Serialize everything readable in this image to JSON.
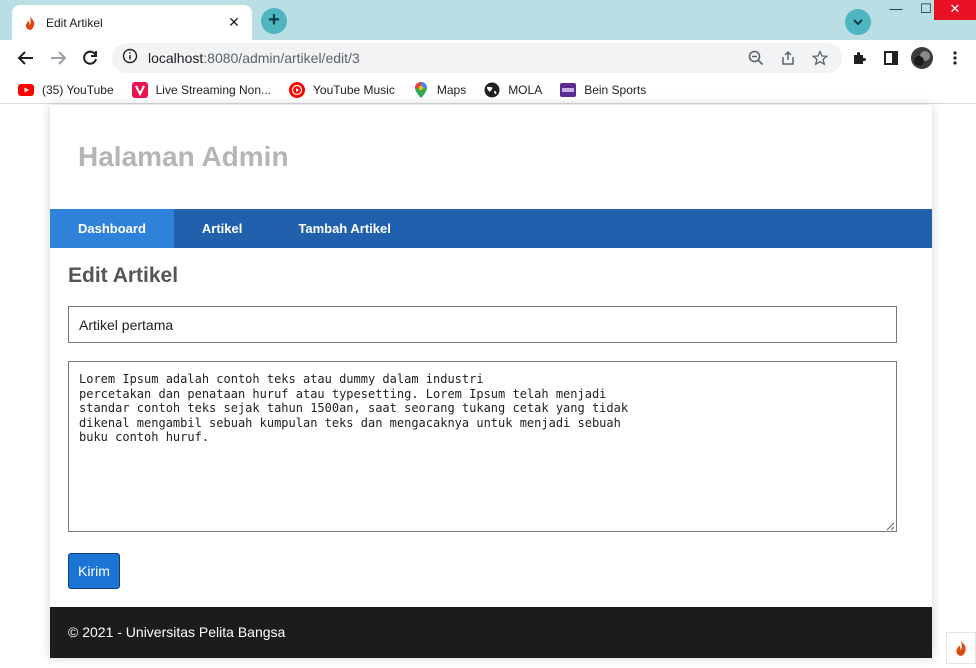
{
  "browser": {
    "tab_title": "Edit Artikel",
    "url_host": "localhost",
    "url_path": ":8080/admin/artikel/edit/3",
    "bookmarks": [
      {
        "label": "(35) YouTube",
        "icon": "youtube-icon"
      },
      {
        "label": "Live Streaming Non...",
        "icon": "vidio-icon"
      },
      {
        "label": "YouTube Music",
        "icon": "youtube-music-icon"
      },
      {
        "label": "Maps",
        "icon": "maps-pin-icon"
      },
      {
        "label": "MOLA",
        "icon": "globe-icon"
      },
      {
        "label": "Bein Sports",
        "icon": "bein-icon"
      }
    ],
    "accent_color": "#b9dfe4"
  },
  "page": {
    "site_title": "Halaman Admin",
    "nav": [
      {
        "label": "Dashboard",
        "active": true
      },
      {
        "label": "Artikel",
        "active": false
      },
      {
        "label": "Tambah Artikel",
        "active": false
      }
    ],
    "heading": "Edit Artikel",
    "form": {
      "title_value": "Artikel pertama",
      "body_value": "Lorem Ipsum adalah contoh teks atau dummy dalam industri\npercetakan dan penataan huruf atau typesetting. Lorem Ipsum telah menjadi\nstandar contoh teks sejak tahun 1500an, saat seorang tukang cetak yang tidak\ndikenal mengambil sebuah kumpulan teks dan mengacaknya untuk menjadi sebuah\nbuku contoh huruf.",
      "submit_label": "Kirim"
    },
    "footer": "© 2021 - Universitas Pelita Bangsa",
    "nav_color": "#2160ac",
    "nav_active_color": "#2e82da",
    "footer_color": "#1c1c1c"
  }
}
